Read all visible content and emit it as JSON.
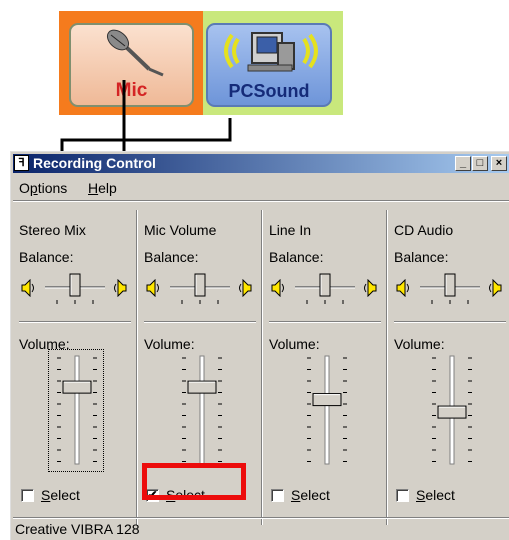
{
  "sources": {
    "mic": {
      "label": "Mic",
      "icon": "microphone-icon",
      "selected": true,
      "accent": "#f57b1d"
    },
    "pcsound": {
      "label": "PCSound",
      "icon": "computer-speakers-icon",
      "selected": false
    }
  },
  "window": {
    "title": "Recording Control",
    "icon": "mixer-app-icon",
    "buttons": {
      "minimize": "_",
      "maximize": "□",
      "close": "×"
    }
  },
  "menu": {
    "options": {
      "label": "Options",
      "mnemonic": "p"
    },
    "help": {
      "label": "Help",
      "mnemonic": "H"
    }
  },
  "channels": [
    {
      "name": "Stereo Mix",
      "balance_label": "Balance:",
      "volume_label": "Volume:",
      "select_label": "Select",
      "selected": false,
      "volume_level": 0.72,
      "balance": 0
    },
    {
      "name": "Mic Volume",
      "balance_label": "Balance:",
      "volume_label": "Volume:",
      "select_label": "Select",
      "selected": true,
      "volume_level": 0.72,
      "balance": 0
    },
    {
      "name": "Line In",
      "balance_label": "Balance:",
      "volume_label": "Volume:",
      "select_label": "Select",
      "selected": false,
      "volume_level": 0.6,
      "balance": 0
    },
    {
      "name": "CD Audio",
      "balance_label": "Balance:",
      "volume_label": "Volume:",
      "select_label": "Select",
      "selected": false,
      "volume_level": 0.48,
      "balance": 0
    }
  ],
  "status": "Creative VIBRA 128",
  "colors": {
    "highlight": "#ec0c0c",
    "titlebar_start": "#0a246a",
    "titlebar_end": "#a6caf0",
    "dialog": "#d4d0c8"
  }
}
